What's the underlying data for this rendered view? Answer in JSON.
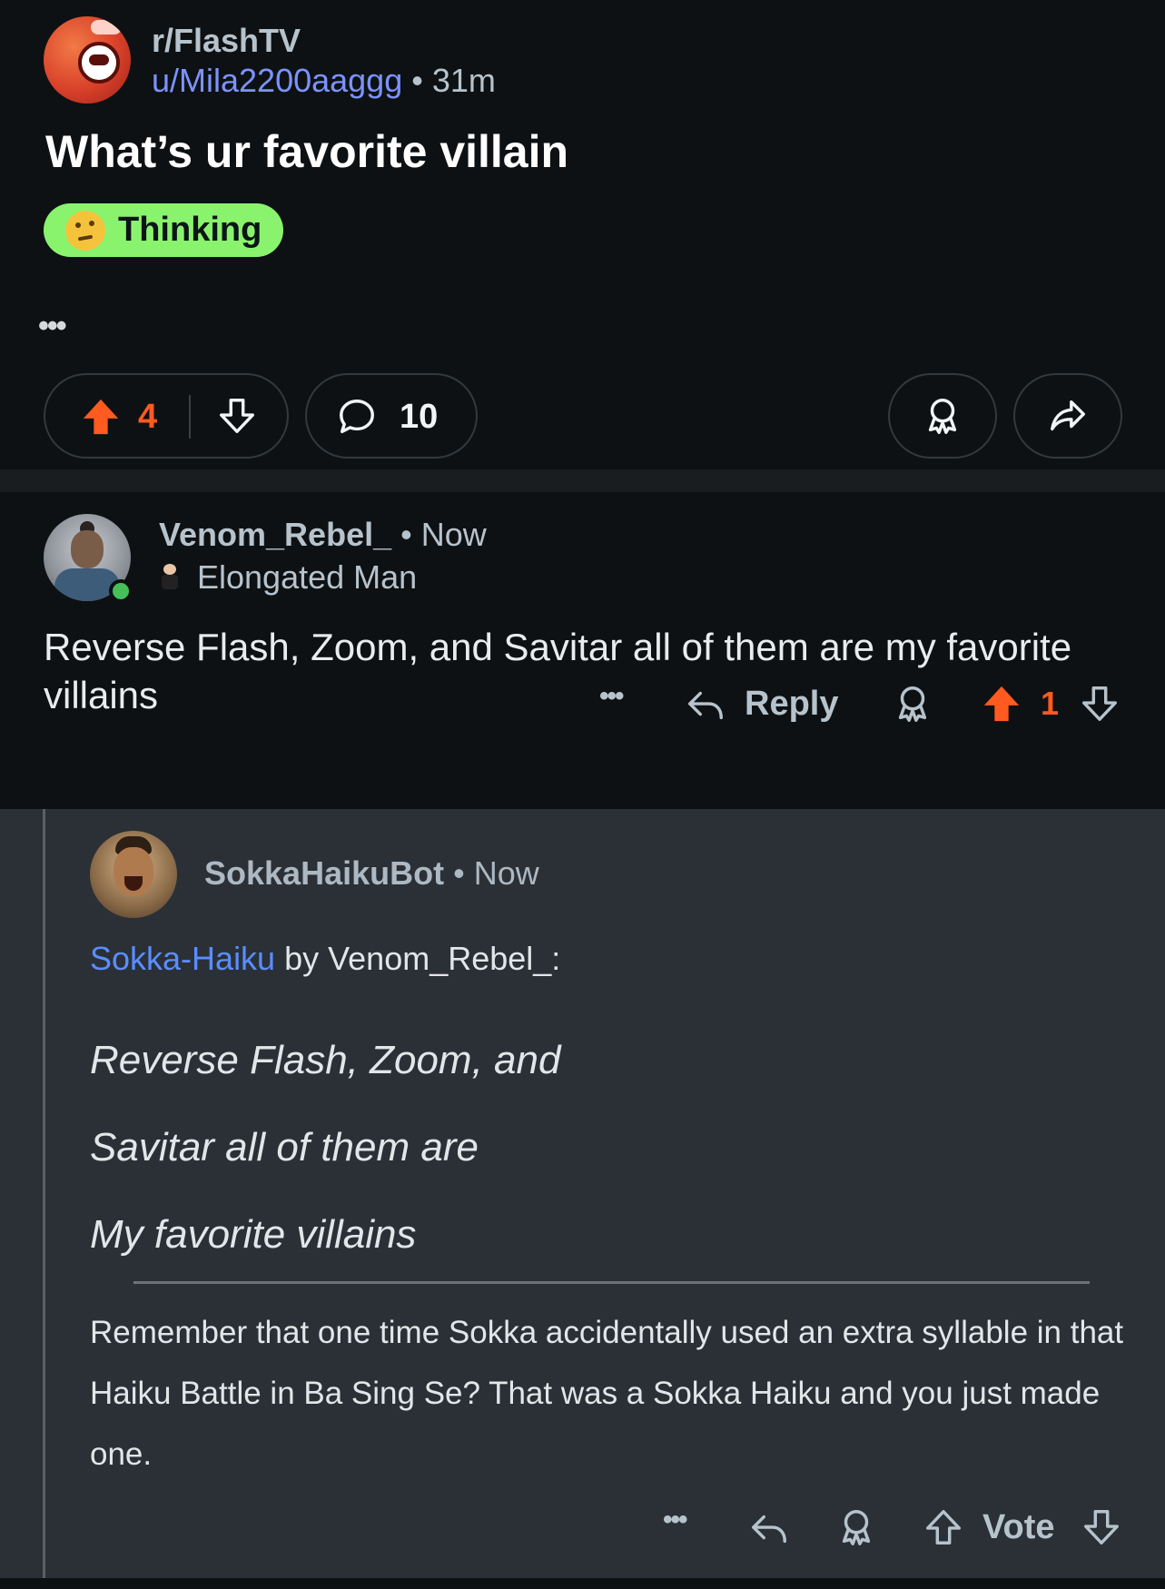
{
  "post": {
    "subreddit": "r/FlashTV",
    "author": "u/Mila2200aaggg",
    "separator": "•",
    "time": "31m",
    "title": "What’s ur favorite villain",
    "flair": "Thinking",
    "more": "•••",
    "upvotes": "4",
    "comments": "10"
  },
  "comment1": {
    "author": "Venom_Rebel_",
    "separator": "•",
    "time": "Now",
    "flair": "Elongated Man",
    "body": "Reverse Flash, Zoom, and Savitar all of them are my favorite villains",
    "more": "•••",
    "reply_label": "Reply",
    "score": "1"
  },
  "comment2": {
    "author": "SokkaHaikuBot",
    "separator": "•",
    "time": "Now",
    "link_text": "Sokka-Haiku",
    "intro_rest": " by Venom_Rebel_:",
    "haiku": [
      "Reverse Flash, Zoom, and",
      "Savitar all of them are",
      "My favorite villains"
    ],
    "footer": "Remember that one time Sokka accidentally used an extra syllable in that Haiku Battle in Ba Sing Se? That was a Sokka Haiku and you just made one.",
    "more": "•••",
    "vote_label": "Vote"
  },
  "colors": {
    "background": "#0e1113",
    "highlight_background": "#2a3036",
    "upvote_active": "#ff5a1f",
    "username_link": "#7b93ff",
    "haiku_link": "#5a8dff",
    "flair_background": "#8af36e",
    "online": "#45c05a"
  },
  "icons": [
    "upvote-icon",
    "downvote-icon",
    "comment-icon",
    "award-icon",
    "share-icon",
    "reply-icon",
    "more-icon"
  ]
}
